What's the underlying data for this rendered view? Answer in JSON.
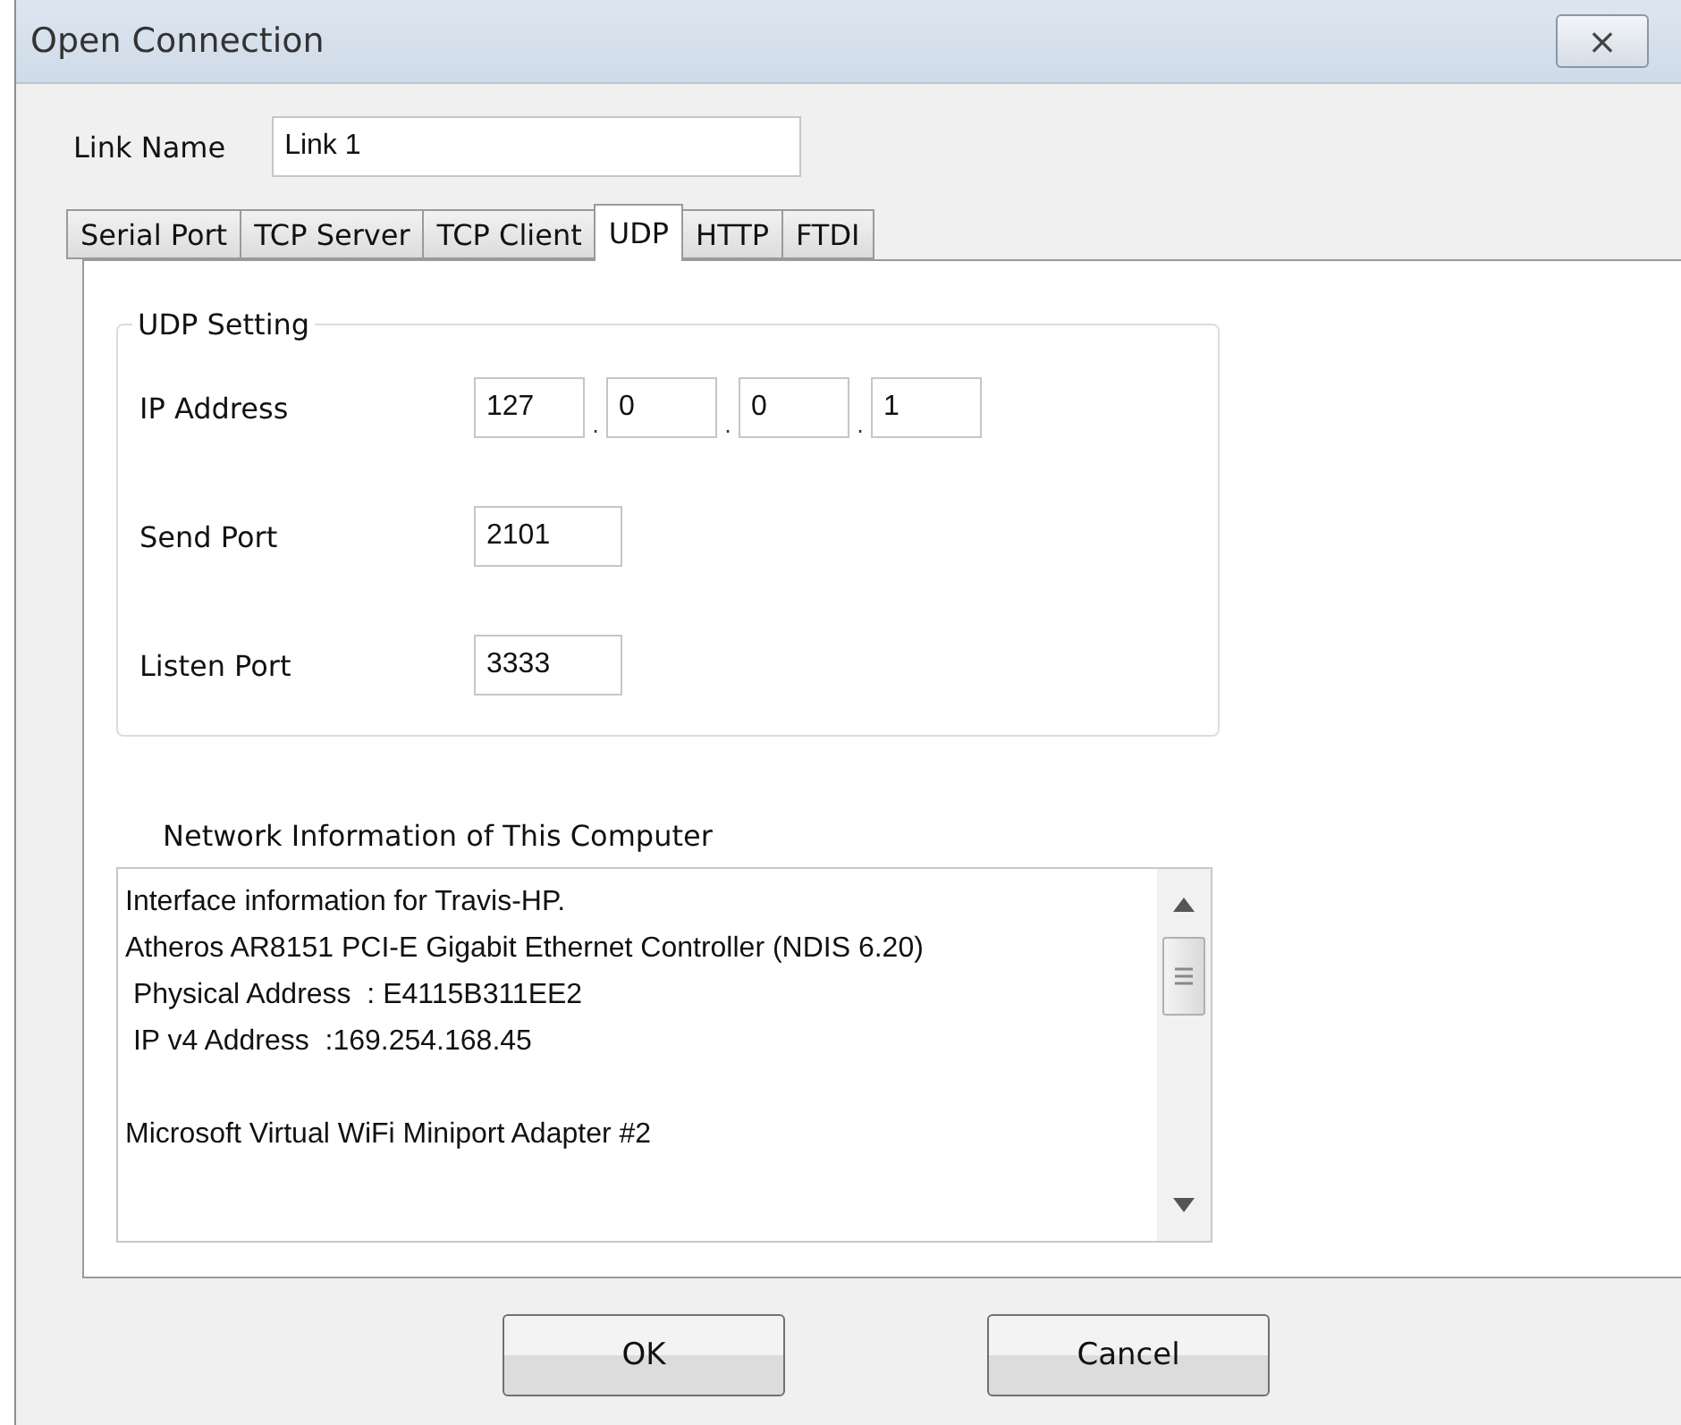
{
  "window": {
    "title": "Open Connection",
    "close_glyph": "⨯"
  },
  "link_name": {
    "label": "Link Name",
    "value": "Link 1"
  },
  "tabs": [
    {
      "label": "Serial Port",
      "selected": false
    },
    {
      "label": "TCP Server",
      "selected": false
    },
    {
      "label": "TCP Client",
      "selected": false
    },
    {
      "label": "UDP",
      "selected": true
    },
    {
      "label": "HTTP",
      "selected": false
    },
    {
      "label": "FTDI",
      "selected": false
    }
  ],
  "udp_setting": {
    "title": "UDP Setting",
    "ip_label": "IP Address",
    "ip_octets": [
      "127",
      "0",
      "0",
      "1"
    ],
    "ip_separators": [
      ".",
      ".",
      "."
    ],
    "send_port_label": "Send Port",
    "send_port": "2101",
    "listen_port_label": "Listen Port",
    "listen_port": "3333"
  },
  "network_info": {
    "title": "Network Information of This Computer",
    "lines": [
      {
        "kind": "text",
        "text": "Interface information for Travis-HP."
      },
      {
        "kind": "text",
        "text": "Atheros AR8151 PCI-E Gigabit Ethernet Controller (NDIS 6.20)"
      },
      {
        "kind": "text",
        "text": " Physical Address  : E4115B311EE2"
      },
      {
        "kind": "text",
        "text": " IP v4 Address  :169.254.168.45"
      },
      {
        "kind": "blank"
      },
      {
        "kind": "text",
        "text": "Microsoft Virtual WiFi Miniport Adapter #2"
      }
    ]
  },
  "buttons": [
    "OK",
    "Cancel"
  ]
}
